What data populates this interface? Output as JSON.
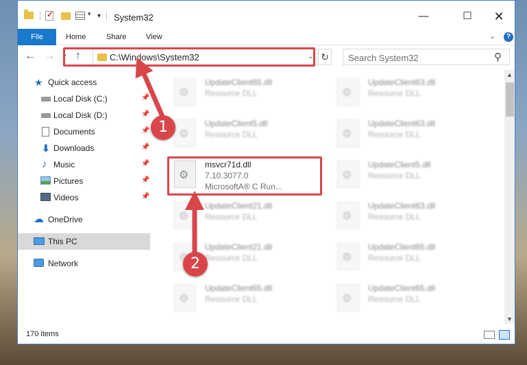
{
  "window": {
    "title": "System32",
    "controls": {
      "minimize": "—",
      "maximize": "☐",
      "close": "✕"
    }
  },
  "ribbon": {
    "tabs": [
      "File",
      "Home",
      "Share",
      "View"
    ],
    "help": "?"
  },
  "nav": {
    "address": "C:\\Windows\\System32",
    "search_placeholder": "Search System32"
  },
  "sidebar": {
    "items": [
      {
        "label": "Quick access",
        "icon": "star-icon"
      },
      {
        "label": "Local Disk (C:)",
        "icon": "drive-icon",
        "pinned": true
      },
      {
        "label": "Local Disk (D:)",
        "icon": "drive-icon",
        "pinned": true
      },
      {
        "label": "Documents",
        "icon": "documents-icon",
        "pinned": true
      },
      {
        "label": "Downloads",
        "icon": "downloads-icon",
        "pinned": true
      },
      {
        "label": "Music",
        "icon": "music-icon",
        "pinned": true
      },
      {
        "label": "Pictures",
        "icon": "pictures-icon",
        "pinned": true
      },
      {
        "label": "Videos",
        "icon": "videos-icon",
        "pinned": true
      },
      {
        "label": "OneDrive",
        "icon": "onedrive-icon"
      },
      {
        "label": "This PC",
        "icon": "pc-icon",
        "selected": true
      },
      {
        "label": "Network",
        "icon": "network-icon"
      }
    ]
  },
  "files": {
    "col1": [
      {
        "name": "UpdateClient65.dll",
        "sub": "Resource DLL"
      },
      {
        "name": "UpdateClient5.dll",
        "sub": "Resource DLL"
      },
      {
        "name": "msvcr71d.dll",
        "sub": "7.10.3077.0",
        "sub2": "MicrosoftA® C Run...",
        "highlighted": true
      },
      {
        "name": "UpdateClient21.dll",
        "sub": "Resource DLL"
      },
      {
        "name": "UpdateClient21.dll",
        "sub": "Resource DLL"
      },
      {
        "name": "UpdateClient65.dll",
        "sub": "Resource DLL"
      }
    ],
    "col2": [
      {
        "name": "UpdateClient63.dll",
        "sub": "Resource DLL"
      },
      {
        "name": "UpdateClient63.dll",
        "sub": "Resource DLL"
      },
      {
        "name": "UpdateClient5.dll",
        "sub": "Resource DLL"
      },
      {
        "name": "UpdateClient63.dll",
        "sub": "Resource DLL"
      },
      {
        "name": "UpdateClient65.dll",
        "sub": "Resource DLL"
      },
      {
        "name": "UpdateClient65.dll",
        "sub": "Resource DLL"
      }
    ]
  },
  "status": {
    "item_count": "170 items"
  },
  "annotations": {
    "step1": "1",
    "step2": "2",
    "color": "#d9464a"
  }
}
